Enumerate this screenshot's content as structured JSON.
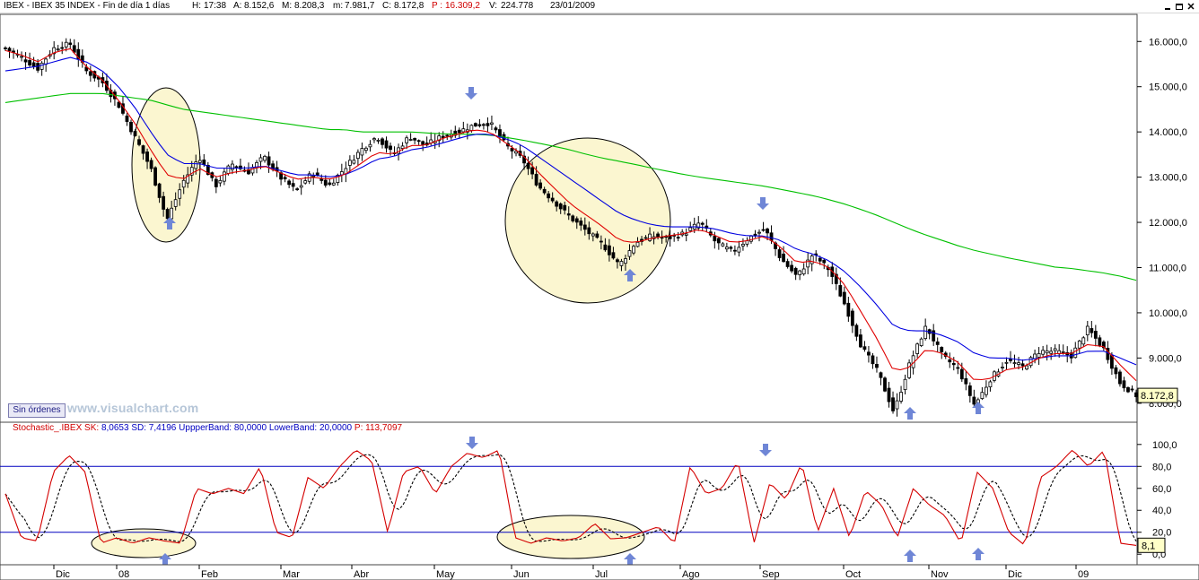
{
  "window": {
    "title": "IBEX - IBEX 35 INDEX - Fin de día 1 días",
    "readouts": [
      {
        "label": "H:",
        "value": "17:38"
      },
      {
        "label": "A:",
        "value": "8.152,6"
      },
      {
        "label": "M:",
        "value": "8.208,3"
      },
      {
        "label": "m:",
        "value": "7.981,7"
      },
      {
        "label": "C:",
        "value": "8.172,8"
      },
      {
        "label": "P :",
        "value": "16.309,2"
      },
      {
        "label": "V:",
        "value": "224.778"
      },
      {
        "label": "",
        "value": "23/01/2009"
      }
    ],
    "minimize_icon": "minimize-icon",
    "restore_icon": "restore-icon",
    "close_icon": "close-icon"
  },
  "toolbar": {
    "sin_ordenes_label": "Sin órdenes"
  },
  "watermark": "www.visualchart.com",
  "stochastic_bar": {
    "name": "Stochastic_.IBEX",
    "sk_label": "SK:",
    "sk_value": "8,0653",
    "sd_label": "SD:",
    "sd_value": "7,4196",
    "upper_label": "UppperBand:",
    "upper_value": "80,0000",
    "lower_label": "LowerBand:",
    "lower_value": "20,0000",
    "p_label": "P:",
    "p_value": "113,7097"
  },
  "colors": {
    "candle": "#000000",
    "ma_short": "#e00000",
    "ma_medium": "#0000e0",
    "ma_long": "#00c000",
    "stoch_k": "#d40000",
    "stoch_d": "#000000",
    "band": "#0000c0",
    "highlight_fill": "#fbf6d0",
    "arrow": "#6f86d6",
    "last_value_box": "#ffffc8",
    "title_red": "#d00000",
    "title_blue": "#0000c0"
  },
  "icons": {
    "marker": "arrow-marker-icon"
  },
  "chart_data": [
    {
      "type": "candlestick",
      "title": "IBEX - IBEX 35 INDEX",
      "yticks": [
        "8.000,0",
        "9.000,0",
        "10.000,0",
        "11.000,0",
        "12.000,0",
        "13.000,0",
        "14.000,0",
        "15.000,0",
        "16.000,0"
      ],
      "ylim": [
        7600,
        16600
      ],
      "last_value_label": "8.172,8",
      "anchors": [
        15850,
        15650,
        15400,
        15850,
        15950,
        15350,
        15100,
        14600,
        13900,
        13200,
        12050,
        12900,
        13450,
        12800,
        13300,
        13100,
        13450,
        13000,
        12700,
        13100,
        12800,
        13200,
        13600,
        13900,
        13500,
        13900,
        13700,
        13900,
        14000,
        14150,
        14200,
        13700,
        13400,
        12800,
        12450,
        12100,
        11800,
        11500,
        11050,
        11550,
        11700,
        11650,
        11750,
        12000,
        11550,
        11350,
        11650,
        11850,
        11200,
        10800,
        11300,
        10950,
        10150,
        9250,
        8700,
        7800,
        8900,
        9700,
        9050,
        8750,
        7950,
        8550,
        8950,
        8800,
        9150,
        9150,
        9050,
        9650,
        9200,
        8450,
        8173
      ],
      "ma_short": [
        15800,
        15700,
        15550,
        15750,
        15850,
        15450,
        15150,
        14700,
        14200,
        13600,
        13050,
        12950,
        13200,
        13000,
        13100,
        13150,
        13250,
        13100,
        12950,
        13000,
        12950,
        13050,
        13300,
        13550,
        13500,
        13700,
        13700,
        13850,
        13950,
        14050,
        14000,
        13750,
        13500,
        13100,
        12750,
        12400,
        12150,
        11900,
        11600,
        11550,
        11650,
        11700,
        11750,
        11850,
        11700,
        11550,
        11600,
        11700,
        11450,
        11100,
        11150,
        11000,
        10600,
        10000,
        9400,
        8700,
        8800,
        9200,
        9100,
        8900,
        8500,
        8550,
        8750,
        8800,
        9000,
        9100,
        9100,
        9300,
        9250,
        8850,
        8500
      ],
      "ma_medium": [
        15350,
        15400,
        15450,
        15550,
        15650,
        15550,
        15350,
        15000,
        14550,
        14000,
        13500,
        13300,
        13300,
        13200,
        13200,
        13200,
        13250,
        13150,
        13050,
        13050,
        13000,
        13050,
        13200,
        13400,
        13450,
        13600,
        13650,
        13750,
        13850,
        13950,
        13950,
        13850,
        13700,
        13450,
        13200,
        12950,
        12700,
        12450,
        12200,
        12050,
        11950,
        11900,
        11900,
        11900,
        11850,
        11750,
        11700,
        11700,
        11600,
        11400,
        11300,
        11150,
        10900,
        10550,
        10150,
        9700,
        9600,
        9600,
        9500,
        9350,
        9100,
        9000,
        9000,
        8950,
        9000,
        9050,
        9050,
        9150,
        9150,
        9000,
        8850
      ],
      "ma_long": [
        14650,
        14700,
        14750,
        14800,
        14850,
        14850,
        14850,
        14800,
        14750,
        14700,
        14600,
        14500,
        14450,
        14400,
        14350,
        14300,
        14250,
        14200,
        14150,
        14100,
        14050,
        14050,
        14000,
        14000,
        14000,
        14000,
        13980,
        13960,
        13950,
        13950,
        13930,
        13880,
        13820,
        13750,
        13680,
        13600,
        13500,
        13420,
        13350,
        13280,
        13200,
        13130,
        13060,
        13000,
        12950,
        12900,
        12850,
        12800,
        12730,
        12660,
        12590,
        12500,
        12400,
        12280,
        12150,
        12000,
        11850,
        11720,
        11600,
        11480,
        11380,
        11300,
        11220,
        11150,
        11080,
        11010,
        10980,
        10930,
        10880,
        10810,
        10720
      ]
    },
    {
      "type": "line",
      "title": "Stochastic_.IBEX",
      "ylim": [
        -8,
        108
      ],
      "yticks": [
        "0,0",
        "20,0",
        "40,0",
        "60,0",
        "80,0",
        "100,0"
      ],
      "bands": {
        "upper": 80,
        "lower": 20
      },
      "last_value_label": "8,1",
      "x_labels": [
        "Dic",
        "08",
        "Feb",
        "Mar",
        "Abr",
        "May",
        "Jun",
        "Jul",
        "Ago",
        "Sep",
        "Oct",
        "Nov",
        "Dic",
        "09"
      ],
      "k_anchors": [
        55,
        15,
        12,
        75,
        90,
        75,
        10,
        15,
        10,
        15,
        12,
        10,
        60,
        55,
        60,
        55,
        80,
        20,
        15,
        70,
        60,
        80,
        95,
        85,
        20,
        75,
        80,
        55,
        80,
        92,
        88,
        95,
        15,
        10,
        15,
        12,
        15,
        28,
        14,
        15,
        20,
        25,
        10,
        80,
        55,
        60,
        85,
        10,
        65,
        50,
        83,
        20,
        60,
        15,
        58,
        45,
        15,
        60,
        45,
        35,
        10,
        75,
        60,
        20,
        8,
        70,
        80,
        95,
        80,
        95,
        10,
        8
      ]
    }
  ]
}
